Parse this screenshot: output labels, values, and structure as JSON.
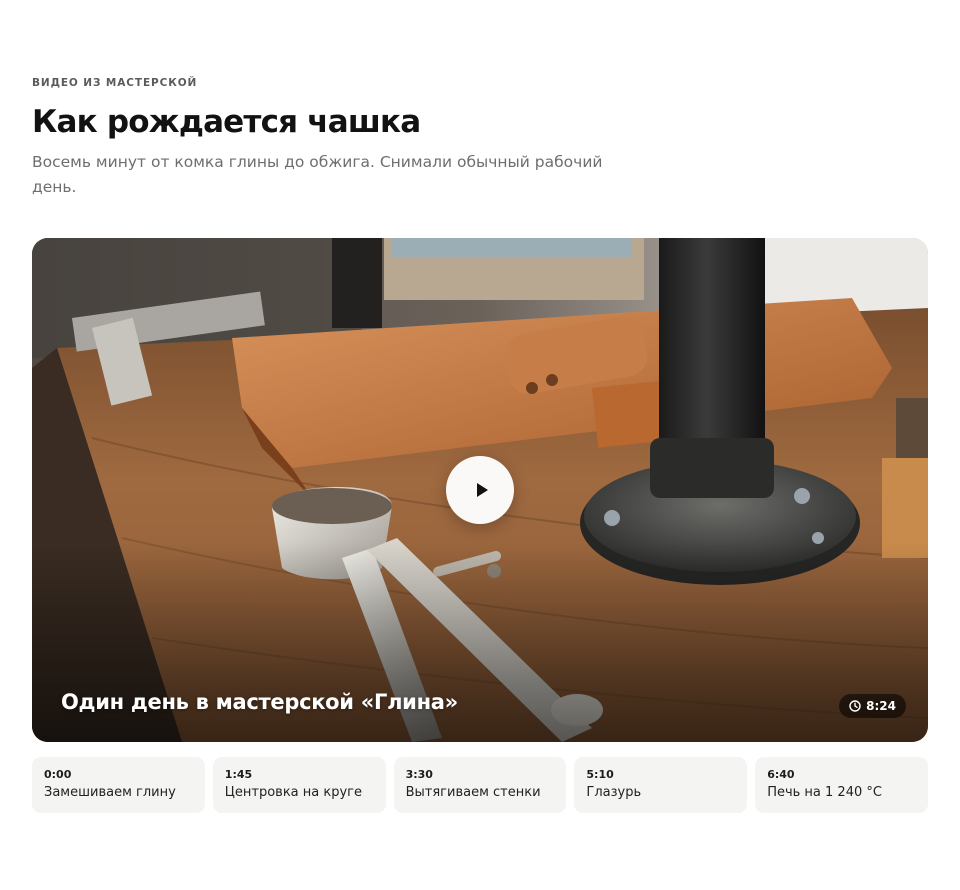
{
  "header": {
    "kicker": "ВИДЕО ИЗ МАСТЕРСКОЙ",
    "title": "Как рождается чашка",
    "subtitle": "Восемь минут от комка глины до обжига. Снимали обычный рабочий день."
  },
  "video": {
    "title": "Один день в мастерской «Глина»",
    "duration": "8:24",
    "play_icon": "play-icon",
    "clock_icon": "clock-icon"
  },
  "chapters": [
    {
      "time": "0:00",
      "label": "Замешиваем глину"
    },
    {
      "time": "1:45",
      "label": "Центровка на круге"
    },
    {
      "time": "3:30",
      "label": "Вытягиваем стенки"
    },
    {
      "time": "5:10",
      "label": "Глазурь"
    },
    {
      "time": "6:40",
      "label": "Печь на 1 240 °C"
    }
  ],
  "colors": {
    "accent_text": "#121212",
    "muted_text": "#6e6e6e",
    "chapter_bg": "#f4f4f2",
    "wood": "#a56b3c",
    "leather": "#c47a45"
  }
}
